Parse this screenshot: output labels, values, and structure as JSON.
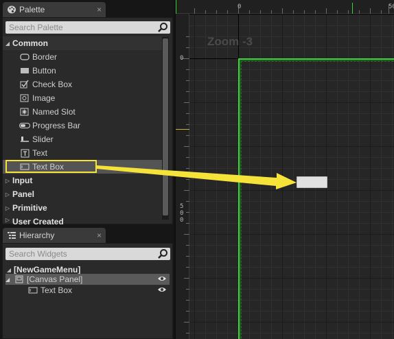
{
  "palette": {
    "tab_label": "Palette",
    "close_glyph": "×",
    "search_placeholder": "Search Palette",
    "categories": [
      {
        "label": "Common",
        "expanded": true
      },
      {
        "label": "Input",
        "expanded": false
      },
      {
        "label": "Panel",
        "expanded": false
      },
      {
        "label": "Primitive",
        "expanded": false
      },
      {
        "label": "User Created",
        "expanded": false
      }
    ],
    "items": [
      {
        "label": "Border",
        "icon": "border-icon"
      },
      {
        "label": "Button",
        "icon": "button-icon"
      },
      {
        "label": "Check Box",
        "icon": "checkbox-icon"
      },
      {
        "label": "Image",
        "icon": "image-icon"
      },
      {
        "label": "Named Slot",
        "icon": "named-slot-icon"
      },
      {
        "label": "Progress Bar",
        "icon": "progress-bar-icon"
      },
      {
        "label": "Slider",
        "icon": "slider-icon"
      },
      {
        "label": "Text",
        "icon": "text-icon"
      },
      {
        "label": "Text Box",
        "icon": "text-box-icon",
        "highlighted": true
      }
    ]
  },
  "hierarchy": {
    "tab_label": "Hierarchy",
    "close_glyph": "×",
    "search_placeholder": "Search Widgets",
    "root": "[NewGameMenu]",
    "canvas_panel": "[Canvas Panel]",
    "child": "Text Box"
  },
  "designer": {
    "zoom_label": "Zoom -3",
    "ruler_top_zero": "0",
    "ruler_top_500": "50",
    "ruler_left_zero": "0",
    "ruler_left_500": [
      "5",
      "0",
      "0"
    ]
  },
  "colors": {
    "highlight": "#f5e33a",
    "selection_border": "#3cd23c",
    "widget_fill": "#e0e0e0"
  }
}
